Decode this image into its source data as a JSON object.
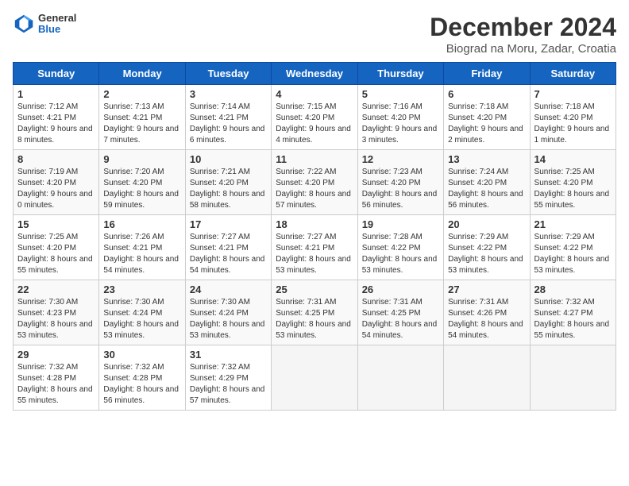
{
  "logo": {
    "line1": "General",
    "line2": "Blue"
  },
  "title": "December 2024",
  "location": "Biograd na Moru, Zadar, Croatia",
  "days_of_week": [
    "Sunday",
    "Monday",
    "Tuesday",
    "Wednesday",
    "Thursday",
    "Friday",
    "Saturday"
  ],
  "weeks": [
    [
      {
        "day": 1,
        "sunrise": "7:12 AM",
        "sunset": "4:21 PM",
        "daylight": "9 hours and 8 minutes."
      },
      {
        "day": 2,
        "sunrise": "7:13 AM",
        "sunset": "4:21 PM",
        "daylight": "9 hours and 7 minutes."
      },
      {
        "day": 3,
        "sunrise": "7:14 AM",
        "sunset": "4:21 PM",
        "daylight": "9 hours and 6 minutes."
      },
      {
        "day": 4,
        "sunrise": "7:15 AM",
        "sunset": "4:20 PM",
        "daylight": "9 hours and 4 minutes."
      },
      {
        "day": 5,
        "sunrise": "7:16 AM",
        "sunset": "4:20 PM",
        "daylight": "9 hours and 3 minutes."
      },
      {
        "day": 6,
        "sunrise": "7:18 AM",
        "sunset": "4:20 PM",
        "daylight": "9 hours and 2 minutes."
      },
      {
        "day": 7,
        "sunrise": "7:18 AM",
        "sunset": "4:20 PM",
        "daylight": "9 hours and 1 minute."
      }
    ],
    [
      {
        "day": 8,
        "sunrise": "7:19 AM",
        "sunset": "4:20 PM",
        "daylight": "9 hours and 0 minutes."
      },
      {
        "day": 9,
        "sunrise": "7:20 AM",
        "sunset": "4:20 PM",
        "daylight": "8 hours and 59 minutes."
      },
      {
        "day": 10,
        "sunrise": "7:21 AM",
        "sunset": "4:20 PM",
        "daylight": "8 hours and 58 minutes."
      },
      {
        "day": 11,
        "sunrise": "7:22 AM",
        "sunset": "4:20 PM",
        "daylight": "8 hours and 57 minutes."
      },
      {
        "day": 12,
        "sunrise": "7:23 AM",
        "sunset": "4:20 PM",
        "daylight": "8 hours and 56 minutes."
      },
      {
        "day": 13,
        "sunrise": "7:24 AM",
        "sunset": "4:20 PM",
        "daylight": "8 hours and 56 minutes."
      },
      {
        "day": 14,
        "sunrise": "7:25 AM",
        "sunset": "4:20 PM",
        "daylight": "8 hours and 55 minutes."
      }
    ],
    [
      {
        "day": 15,
        "sunrise": "7:25 AM",
        "sunset": "4:20 PM",
        "daylight": "8 hours and 55 minutes."
      },
      {
        "day": 16,
        "sunrise": "7:26 AM",
        "sunset": "4:21 PM",
        "daylight": "8 hours and 54 minutes."
      },
      {
        "day": 17,
        "sunrise": "7:27 AM",
        "sunset": "4:21 PM",
        "daylight": "8 hours and 54 minutes."
      },
      {
        "day": 18,
        "sunrise": "7:27 AM",
        "sunset": "4:21 PM",
        "daylight": "8 hours and 53 minutes."
      },
      {
        "day": 19,
        "sunrise": "7:28 AM",
        "sunset": "4:22 PM",
        "daylight": "8 hours and 53 minutes."
      },
      {
        "day": 20,
        "sunrise": "7:29 AM",
        "sunset": "4:22 PM",
        "daylight": "8 hours and 53 minutes."
      },
      {
        "day": 21,
        "sunrise": "7:29 AM",
        "sunset": "4:22 PM",
        "daylight": "8 hours and 53 minutes."
      }
    ],
    [
      {
        "day": 22,
        "sunrise": "7:30 AM",
        "sunset": "4:23 PM",
        "daylight": "8 hours and 53 minutes."
      },
      {
        "day": 23,
        "sunrise": "7:30 AM",
        "sunset": "4:24 PM",
        "daylight": "8 hours and 53 minutes."
      },
      {
        "day": 24,
        "sunrise": "7:30 AM",
        "sunset": "4:24 PM",
        "daylight": "8 hours and 53 minutes."
      },
      {
        "day": 25,
        "sunrise": "7:31 AM",
        "sunset": "4:25 PM",
        "daylight": "8 hours and 53 minutes."
      },
      {
        "day": 26,
        "sunrise": "7:31 AM",
        "sunset": "4:25 PM",
        "daylight": "8 hours and 54 minutes."
      },
      {
        "day": 27,
        "sunrise": "7:31 AM",
        "sunset": "4:26 PM",
        "daylight": "8 hours and 54 minutes."
      },
      {
        "day": 28,
        "sunrise": "7:32 AM",
        "sunset": "4:27 PM",
        "daylight": "8 hours and 55 minutes."
      }
    ],
    [
      {
        "day": 29,
        "sunrise": "7:32 AM",
        "sunset": "4:28 PM",
        "daylight": "8 hours and 55 minutes."
      },
      {
        "day": 30,
        "sunrise": "7:32 AM",
        "sunset": "4:28 PM",
        "daylight": "8 hours and 56 minutes."
      },
      {
        "day": 31,
        "sunrise": "7:32 AM",
        "sunset": "4:29 PM",
        "daylight": "8 hours and 57 minutes."
      },
      null,
      null,
      null,
      null
    ]
  ]
}
